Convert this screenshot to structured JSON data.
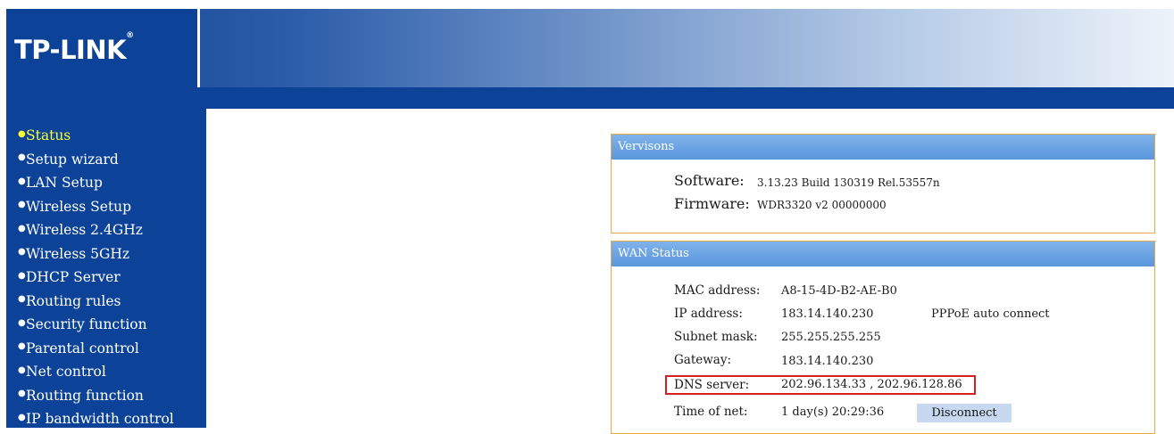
{
  "header": {
    "logo_text": "TP-LINK",
    "logo_reg": "®"
  },
  "sidebar": {
    "items": [
      {
        "label": "Status",
        "active": true
      },
      {
        "label": "Setup wizard",
        "active": false
      },
      {
        "label": "LAN Setup",
        "active": false
      },
      {
        "label": "Wireless Setup",
        "active": false
      },
      {
        "label": "Wireless 2.4GHz",
        "active": false
      },
      {
        "label": "Wireless 5GHz",
        "active": false
      },
      {
        "label": "DHCP Server",
        "active": false
      },
      {
        "label": "Routing rules",
        "active": false
      },
      {
        "label": "Security function",
        "active": false
      },
      {
        "label": "Parental control",
        "active": false
      },
      {
        "label": "Net control",
        "active": false
      },
      {
        "label": "Routing function",
        "active": false
      },
      {
        "label": "IP bandwidth control",
        "active": false
      }
    ]
  },
  "versions": {
    "title": "Vervisons",
    "software_label": "Software:",
    "software_value": "3.13.23 Build 130319 Rel.53557n",
    "firmware_label": "Firmware:",
    "firmware_value": "WDR3320 v2 00000000"
  },
  "wan": {
    "title": "WAN Status",
    "mac_label": "MAC address:",
    "mac_value": "A8-15-4D-B2-AE-B0",
    "ip_label": "IP address:",
    "ip_value": "183.14.140.230",
    "connection_type": "PPPoE auto connect",
    "subnet_label": "Subnet mask:",
    "subnet_value": "255.255.255.255",
    "gateway_label": "Gateway:",
    "gateway_value": "183.14.140.230",
    "dns_label": "DNS server:",
    "dns_value": "202.96.134.33 , 202.96.128.86",
    "time_label": "Time of net:",
    "time_value": "1 day(s) 20:29:36",
    "disconnect_label": "Disconnect"
  },
  "colors": {
    "nav_bg": "#0c4398",
    "nav_active": "#ffff33",
    "panel_border": "#e8a94a",
    "panel_head": "#5a96dc",
    "highlight_box": "#d42020"
  }
}
